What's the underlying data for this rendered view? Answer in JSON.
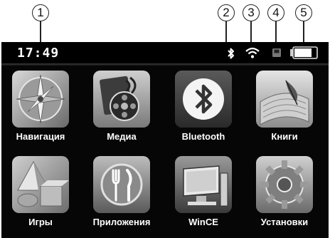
{
  "callouts": [
    "1",
    "2",
    "3",
    "4",
    "5"
  ],
  "status_bar": {
    "time": "17:49",
    "icons": [
      "bluetooth-icon",
      "wifi-icon",
      "memory-card-icon",
      "battery-icon"
    ],
    "battery_level": 0.8
  },
  "menu": {
    "items": [
      {
        "label": "Навигация",
        "icon": "compass-icon"
      },
      {
        "label": "Медиа",
        "icon": "media-film-icon"
      },
      {
        "label": "Bluetooth",
        "icon": "bluetooth-icon"
      },
      {
        "label": "Книги",
        "icon": "book-feather-icon"
      },
      {
        "label": "Игры",
        "icon": "game-shapes-icon"
      },
      {
        "label": "Приложения",
        "icon": "fork-knife-icon"
      },
      {
        "label": "WinCE",
        "icon": "monitor-icon"
      },
      {
        "label": "Установки",
        "icon": "gear-icon"
      }
    ]
  }
}
